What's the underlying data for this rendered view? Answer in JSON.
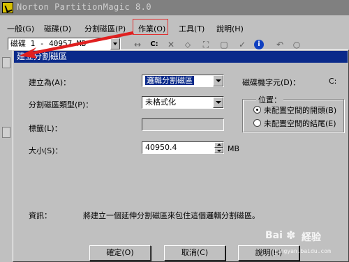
{
  "app": {
    "title": "Norton PartitionMagic 8.0"
  },
  "menu": [
    {
      "label": "一般(G)"
    },
    {
      "label": "磁碟(D)"
    },
    {
      "label": "分割磁區(P)"
    },
    {
      "label": "作業(O)"
    },
    {
      "label": "工具(T)"
    },
    {
      "label": "說明(H)"
    }
  ],
  "toolbar": {
    "disk_value": "磁碟 1 - 40957  MB",
    "drive_letter": "C:"
  },
  "dialog": {
    "title": "建立分割磁區",
    "create_as_label": "建立為(A)：",
    "create_as_value": "邏輯分割磁區",
    "drive_letter_label": "磁碟機字元(D)：",
    "drive_letter_value": "C:",
    "fs_type_label": "分割磁區類型(P)：",
    "fs_type_value": "未格式化",
    "position_legend": "位置：",
    "position_options": [
      {
        "label": "未配置空間的開頭(B)",
        "selected": true
      },
      {
        "label": "未配置空間的結尾(E)",
        "selected": false
      }
    ],
    "tag_label": "標籤(L)：",
    "tag_value": "",
    "size_label": "大小(S)：",
    "size_value": "40950.4",
    "size_unit": "MB",
    "info_label": "資訊：",
    "info_text": "將建立一個延伸分割磁區來包住這個邏輯分割磁區。",
    "buttons": {
      "ok": "確定(O)",
      "cancel": "取消(C)",
      "help": "說明(H)"
    }
  },
  "watermark": {
    "brand": "Bai",
    "brand2": "経验",
    "url": "jingyan.baidu.com"
  },
  "colors": {
    "title_bar": "#0a2a8a",
    "highlight_box": "#e03030",
    "arrow": "#e02020"
  }
}
